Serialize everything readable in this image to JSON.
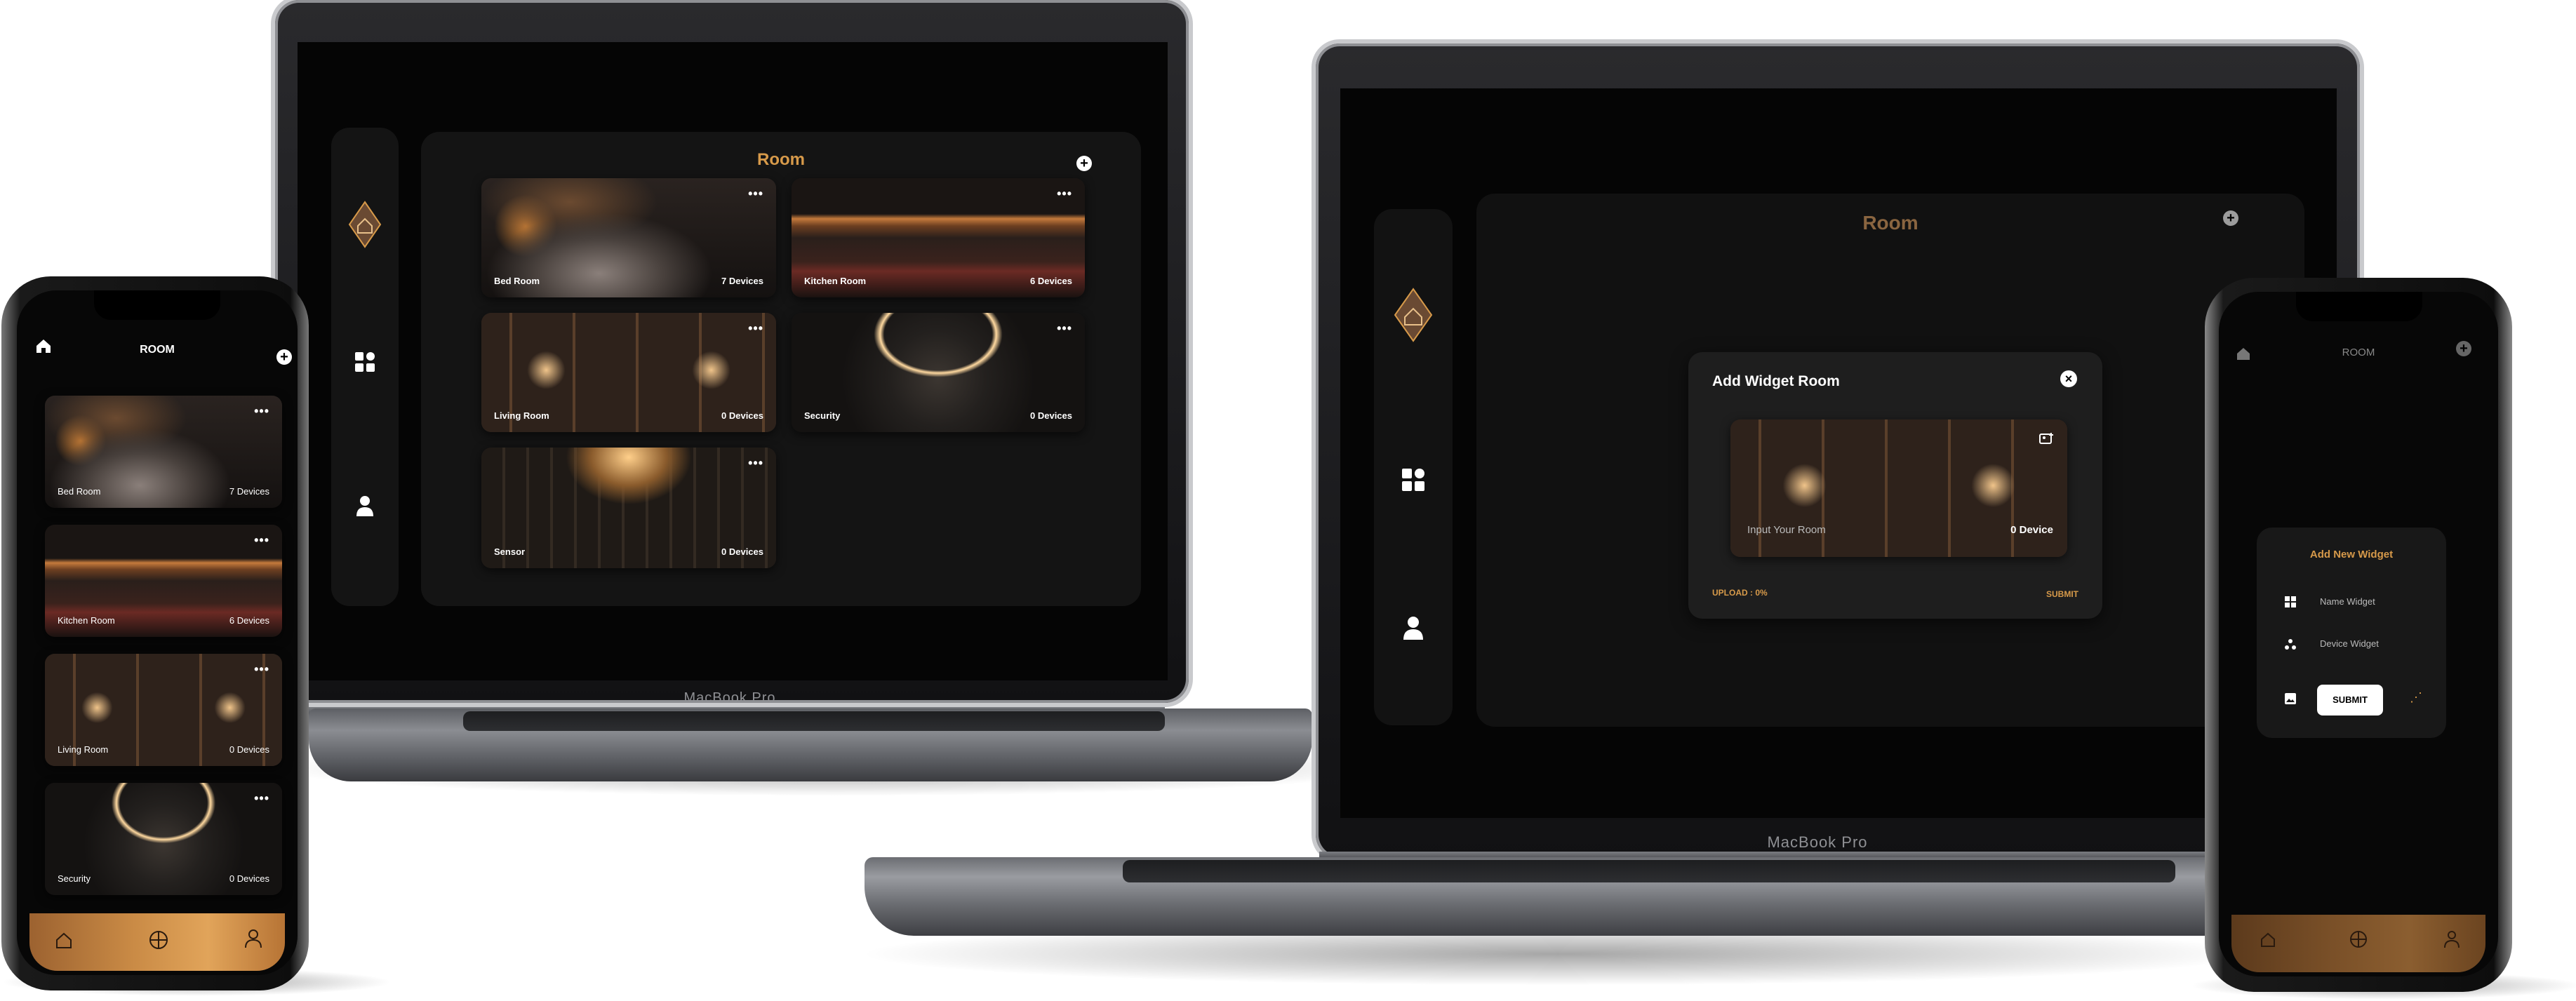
{
  "laptop_left": {
    "brand": "MacBook Pro",
    "title": "Room",
    "rooms": [
      {
        "name": "Bed Room",
        "devices": "7 Devices"
      },
      {
        "name": "Kitchen Room",
        "devices": "6 Devices"
      },
      {
        "name": "Living Room",
        "devices": "0 Devices"
      },
      {
        "name": "Security",
        "devices": "0 Devices"
      },
      {
        "name": "Sensor",
        "devices": "0 Devices"
      }
    ],
    "more_glyph": "•••"
  },
  "laptop_right": {
    "brand": "MacBook Pro",
    "title": "Room",
    "modal": {
      "title": "Add Widget Room",
      "input_placeholder": "Input Your Room",
      "devices": "0 Device",
      "upload": "UPLOAD : 0%",
      "submit": "SUBMIT"
    }
  },
  "phone_left": {
    "title": "ROOM",
    "rooms": [
      {
        "name": "Bed Room",
        "devices": "7 Devices"
      },
      {
        "name": "Kitchen Room",
        "devices": "6 Devices"
      },
      {
        "name": "Living Room",
        "devices": "0 Devices"
      },
      {
        "name": "Security",
        "devices": "0 Devices"
      }
    ]
  },
  "phone_right": {
    "title": "ROOM",
    "form": {
      "title": "Add New Widget",
      "name_placeholder": "Name Widget",
      "device_placeholder": "Device Widget",
      "submit": "SUBMIT"
    }
  },
  "colors": {
    "accent": "#d79a4a",
    "panel": "#141414",
    "bottom_bar": "#c98a45"
  }
}
